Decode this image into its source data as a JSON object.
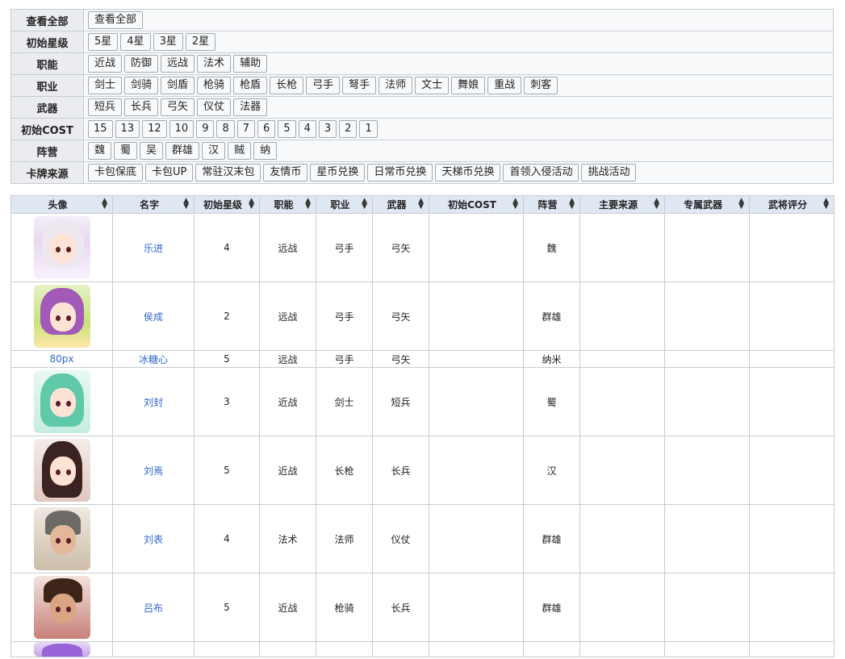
{
  "filters": {
    "all": {
      "label": "查看全部",
      "options": [
        "查看全部"
      ]
    },
    "star": {
      "label": "初始星级",
      "options": [
        "5星",
        "4星",
        "3星",
        "2星"
      ]
    },
    "role": {
      "label": "职能",
      "options": [
        "近战",
        "防御",
        "远战",
        "法术",
        "辅助"
      ]
    },
    "class": {
      "label": "职业",
      "options": [
        "剑士",
        "剑骑",
        "剑盾",
        "枪骑",
        "枪盾",
        "长枪",
        "弓手",
        "弩手",
        "法师",
        "文士",
        "舞娘",
        "重战",
        "刺客"
      ]
    },
    "weapon": {
      "label": "武器",
      "options": [
        "短兵",
        "长兵",
        "弓矢",
        "仪仗",
        "法器"
      ]
    },
    "cost": {
      "label": "初始COST",
      "options": [
        "15",
        "13",
        "12",
        "10",
        "9",
        "8",
        "7",
        "6",
        "5",
        "4",
        "3",
        "2",
        "1"
      ]
    },
    "faction": {
      "label": "阵营",
      "options": [
        "魏",
        "蜀",
        "吴",
        "群雄",
        "汉",
        "贼",
        "纳"
      ]
    },
    "source": {
      "label": "卡牌来源",
      "options": [
        "卡包保底",
        "卡包UP",
        "常驻汉末包",
        "友情币",
        "星币兑换",
        "日常币兑换",
        "天梯币兑换",
        "首领入侵活动",
        "挑战活动"
      ]
    }
  },
  "table": {
    "headers": [
      "头像",
      "名字",
      "初始星级",
      "职能",
      "职业",
      "武器",
      "初始COST",
      "阵营",
      "主要来源",
      "专属武器",
      "武将评分"
    ],
    "rows": [
      {
        "avatar": "",
        "name": "乐进",
        "star": "4",
        "role": "远战",
        "class": "弓手",
        "weapon": "弓矢",
        "cost": "",
        "faction": "魏",
        "source": "",
        "exclusive": "",
        "score": ""
      },
      {
        "avatar": "",
        "name": "侯成",
        "star": "2",
        "role": "远战",
        "class": "弓手",
        "weapon": "弓矢",
        "cost": "",
        "faction": "群雄",
        "source": "",
        "exclusive": "",
        "score": ""
      },
      {
        "avatar": "80px",
        "name": "冰糖心",
        "star": "5",
        "role": "远战",
        "class": "弓手",
        "weapon": "弓矢",
        "cost": "",
        "faction": "纳米",
        "source": "",
        "exclusive": "",
        "score": ""
      },
      {
        "avatar": "",
        "name": "刘封",
        "star": "3",
        "role": "近战",
        "class": "剑士",
        "weapon": "短兵",
        "cost": "",
        "faction": "蜀",
        "source": "",
        "exclusive": "",
        "score": ""
      },
      {
        "avatar": "",
        "name": "刘焉",
        "star": "5",
        "role": "近战",
        "class": "长枪",
        "weapon": "长兵",
        "cost": "",
        "faction": "汉",
        "source": "",
        "exclusive": "",
        "score": ""
      },
      {
        "avatar": "",
        "name": "刘表",
        "star": "4",
        "role": "法术",
        "class": "法师",
        "weapon": "仪仗",
        "cost": "",
        "faction": "群雄",
        "source": "",
        "exclusive": "",
        "score": ""
      },
      {
        "avatar": "",
        "name": "吕布",
        "star": "5",
        "role": "近战",
        "class": "枪骑",
        "weapon": "长兵",
        "cost": "",
        "faction": "群雄",
        "source": "",
        "exclusive": "",
        "score": ""
      }
    ]
  },
  "colors": {
    "link": "#3366cc",
    "header_bg": "#dfe7f3",
    "label_bg": "#eaecf0",
    "border": "#c8ccd1"
  },
  "icons": {
    "sort": "sort-both-icon"
  }
}
